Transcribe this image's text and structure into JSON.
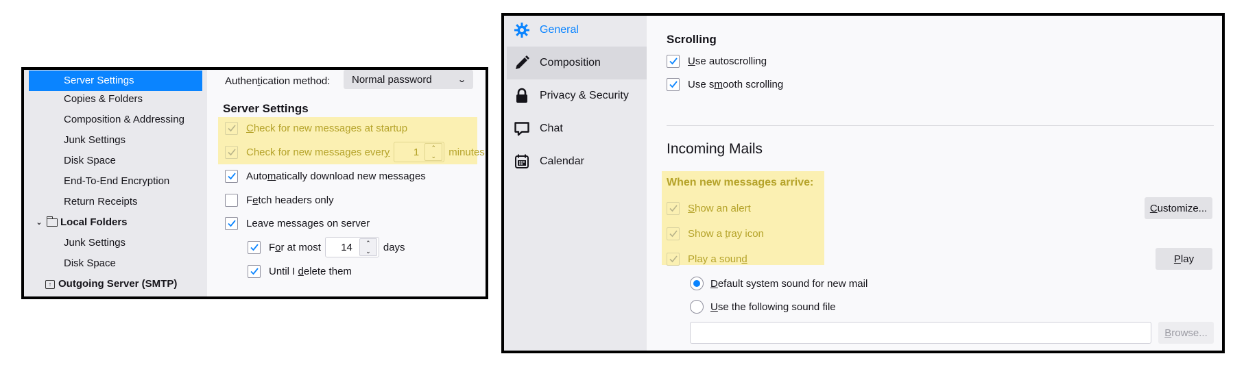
{
  "account_settings": {
    "sidebar": {
      "items": [
        {
          "label": "Server Settings",
          "selected": true
        },
        {
          "label": "Copies & Folders"
        },
        {
          "label": "Composition & Addressing"
        },
        {
          "label": "Junk Settings"
        },
        {
          "label": "Disk Space"
        },
        {
          "label": "End-To-End Encryption"
        },
        {
          "label": "Return Receipts"
        }
      ],
      "local_folders": {
        "label": "Local Folders",
        "icon": "folder-icon",
        "expanded": true,
        "children": [
          {
            "label": "Junk Settings"
          },
          {
            "label": "Disk Space"
          }
        ]
      },
      "outgoing_server": {
        "label": "Outgoing Server (SMTP)",
        "icon": "outgoing-server-icon"
      }
    },
    "auth": {
      "label_pre": "Authen",
      "label_key": "t",
      "label_post": "ication method:",
      "value": "Normal password"
    },
    "section_title": "Server Settings",
    "options": {
      "check_startup": {
        "key": "C",
        "rest": "heck for new messages at startup",
        "checked": true,
        "disabled": true,
        "highlighted": true
      },
      "check_every": {
        "pre": "Check for new messages ever",
        "key": "y",
        "value": "1",
        "suffix": "minutes",
        "checked": true,
        "disabled": true,
        "highlighted": true
      },
      "auto_download": {
        "pre": "Auto",
        "key": "m",
        "post": "atically download new messages",
        "checked": true
      },
      "fetch_headers": {
        "pre": "F",
        "key": "e",
        "post": "tch headers only",
        "checked": false
      },
      "leave_on_server": {
        "pre": "Leave messa",
        "key": "g",
        "post": "es on server",
        "checked": true
      },
      "for_at_most": {
        "pre": "F",
        "key": "o",
        "post": "r at most",
        "value": "14",
        "suffix": "days",
        "checked": true
      },
      "until_delete": {
        "pre": "Until I ",
        "key": "d",
        "post": "elete them",
        "checked": true
      }
    }
  },
  "preferences": {
    "nav": [
      {
        "label": "General",
        "icon": "gear-icon",
        "active": true
      },
      {
        "label": "Composition",
        "icon": "pencil-icon",
        "hover": true
      },
      {
        "label": "Privacy & Security",
        "icon": "lock-icon"
      },
      {
        "label": "Chat",
        "icon": "chat-bubble-icon"
      },
      {
        "label": "Calendar",
        "icon": "calendar-icon"
      }
    ],
    "scrolling": {
      "title": "Scrolling",
      "autoscroll": {
        "key": "U",
        "rest": "se autoscrolling",
        "checked": true
      },
      "smooth": {
        "pre": "Use s",
        "key": "m",
        "post": "ooth scrolling",
        "checked": true
      }
    },
    "incoming": {
      "title": "Incoming Mails",
      "when_label": "When new messages arrive:",
      "show_alert": {
        "key": "S",
        "rest": "how an alert",
        "checked": true,
        "disabled": true
      },
      "tray_icon": {
        "pre": "Show a ",
        "key": "t",
        "post": "ray icon",
        "checked": true,
        "disabled": true
      },
      "play_sound": {
        "pre": "Play a soun",
        "key": "d",
        "checked": true,
        "disabled": true
      },
      "customize_button": {
        "key": "C",
        "rest": "ustomize..."
      },
      "play_button": {
        "key": "P",
        "rest": "lay"
      },
      "sound_default": {
        "key": "D",
        "rest": "efault system sound for new mail",
        "selected": true
      },
      "sound_file": {
        "key": "U",
        "rest": "se the following sound file",
        "selected": false
      },
      "sound_file_path": "",
      "browse_button": {
        "key": "B",
        "rest": "rowse...",
        "disabled": true
      }
    }
  },
  "colors": {
    "accent": "#0a84ff",
    "highlight": "#fbf0b2",
    "disabled_text": "#b5a32a"
  }
}
